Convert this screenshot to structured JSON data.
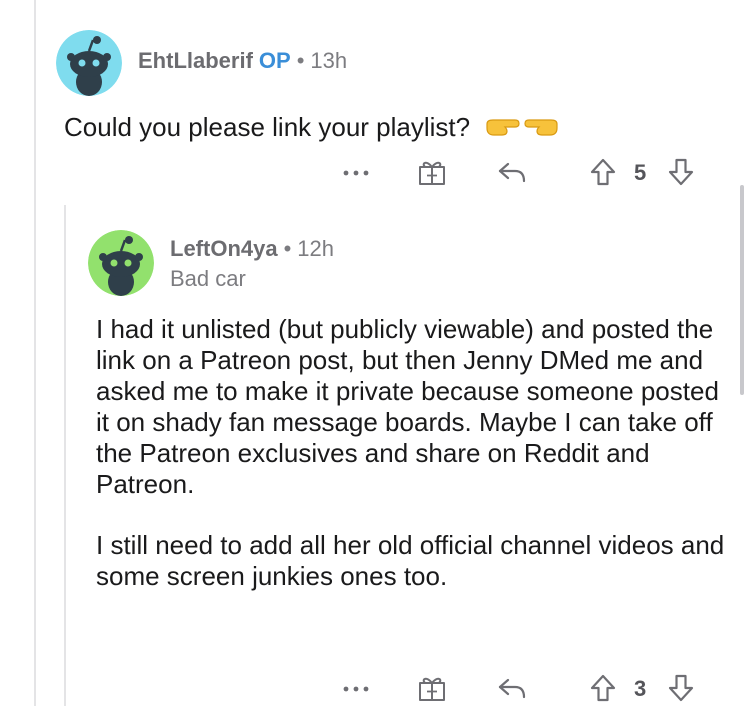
{
  "comments": [
    {
      "username": "EhtLlaberif",
      "op_badge": "OP",
      "separator": "•",
      "time": "13h",
      "avatar_color": "#7fdcee",
      "body": "Could you please link your playlist?",
      "emoji": [
        "backhand-index-pointing-right",
        "backhand-index-pointing-left"
      ],
      "actions": {
        "more": "more-icon",
        "award": "gift-icon",
        "reply": "reply-icon"
      },
      "votes": "5"
    },
    {
      "username": "LeftOn4ya",
      "separator": "•",
      "time": "12h",
      "flair": "Bad car",
      "avatar_color": "#92e16d",
      "paragraphs": [
        "I had it unlisted (but publicly viewable) and posted the link on a Patreon post, but then Jenny DMed me and asked me to make it private because someone posted it on shady fan message boards. Maybe I can take off the Patreon exclusives and share on Reddit and Patreon.",
        "I still need to add all her old official channel videos and some screen junkies ones too."
      ],
      "actions": {
        "more": "more-icon",
        "award": "gift-icon",
        "reply": "reply-icon"
      },
      "votes": "3"
    }
  ],
  "colors": {
    "text": "#1a1a1b",
    "meta": "#7c7c80",
    "op": "#3a8ed8",
    "icons": "#6e6e73"
  }
}
